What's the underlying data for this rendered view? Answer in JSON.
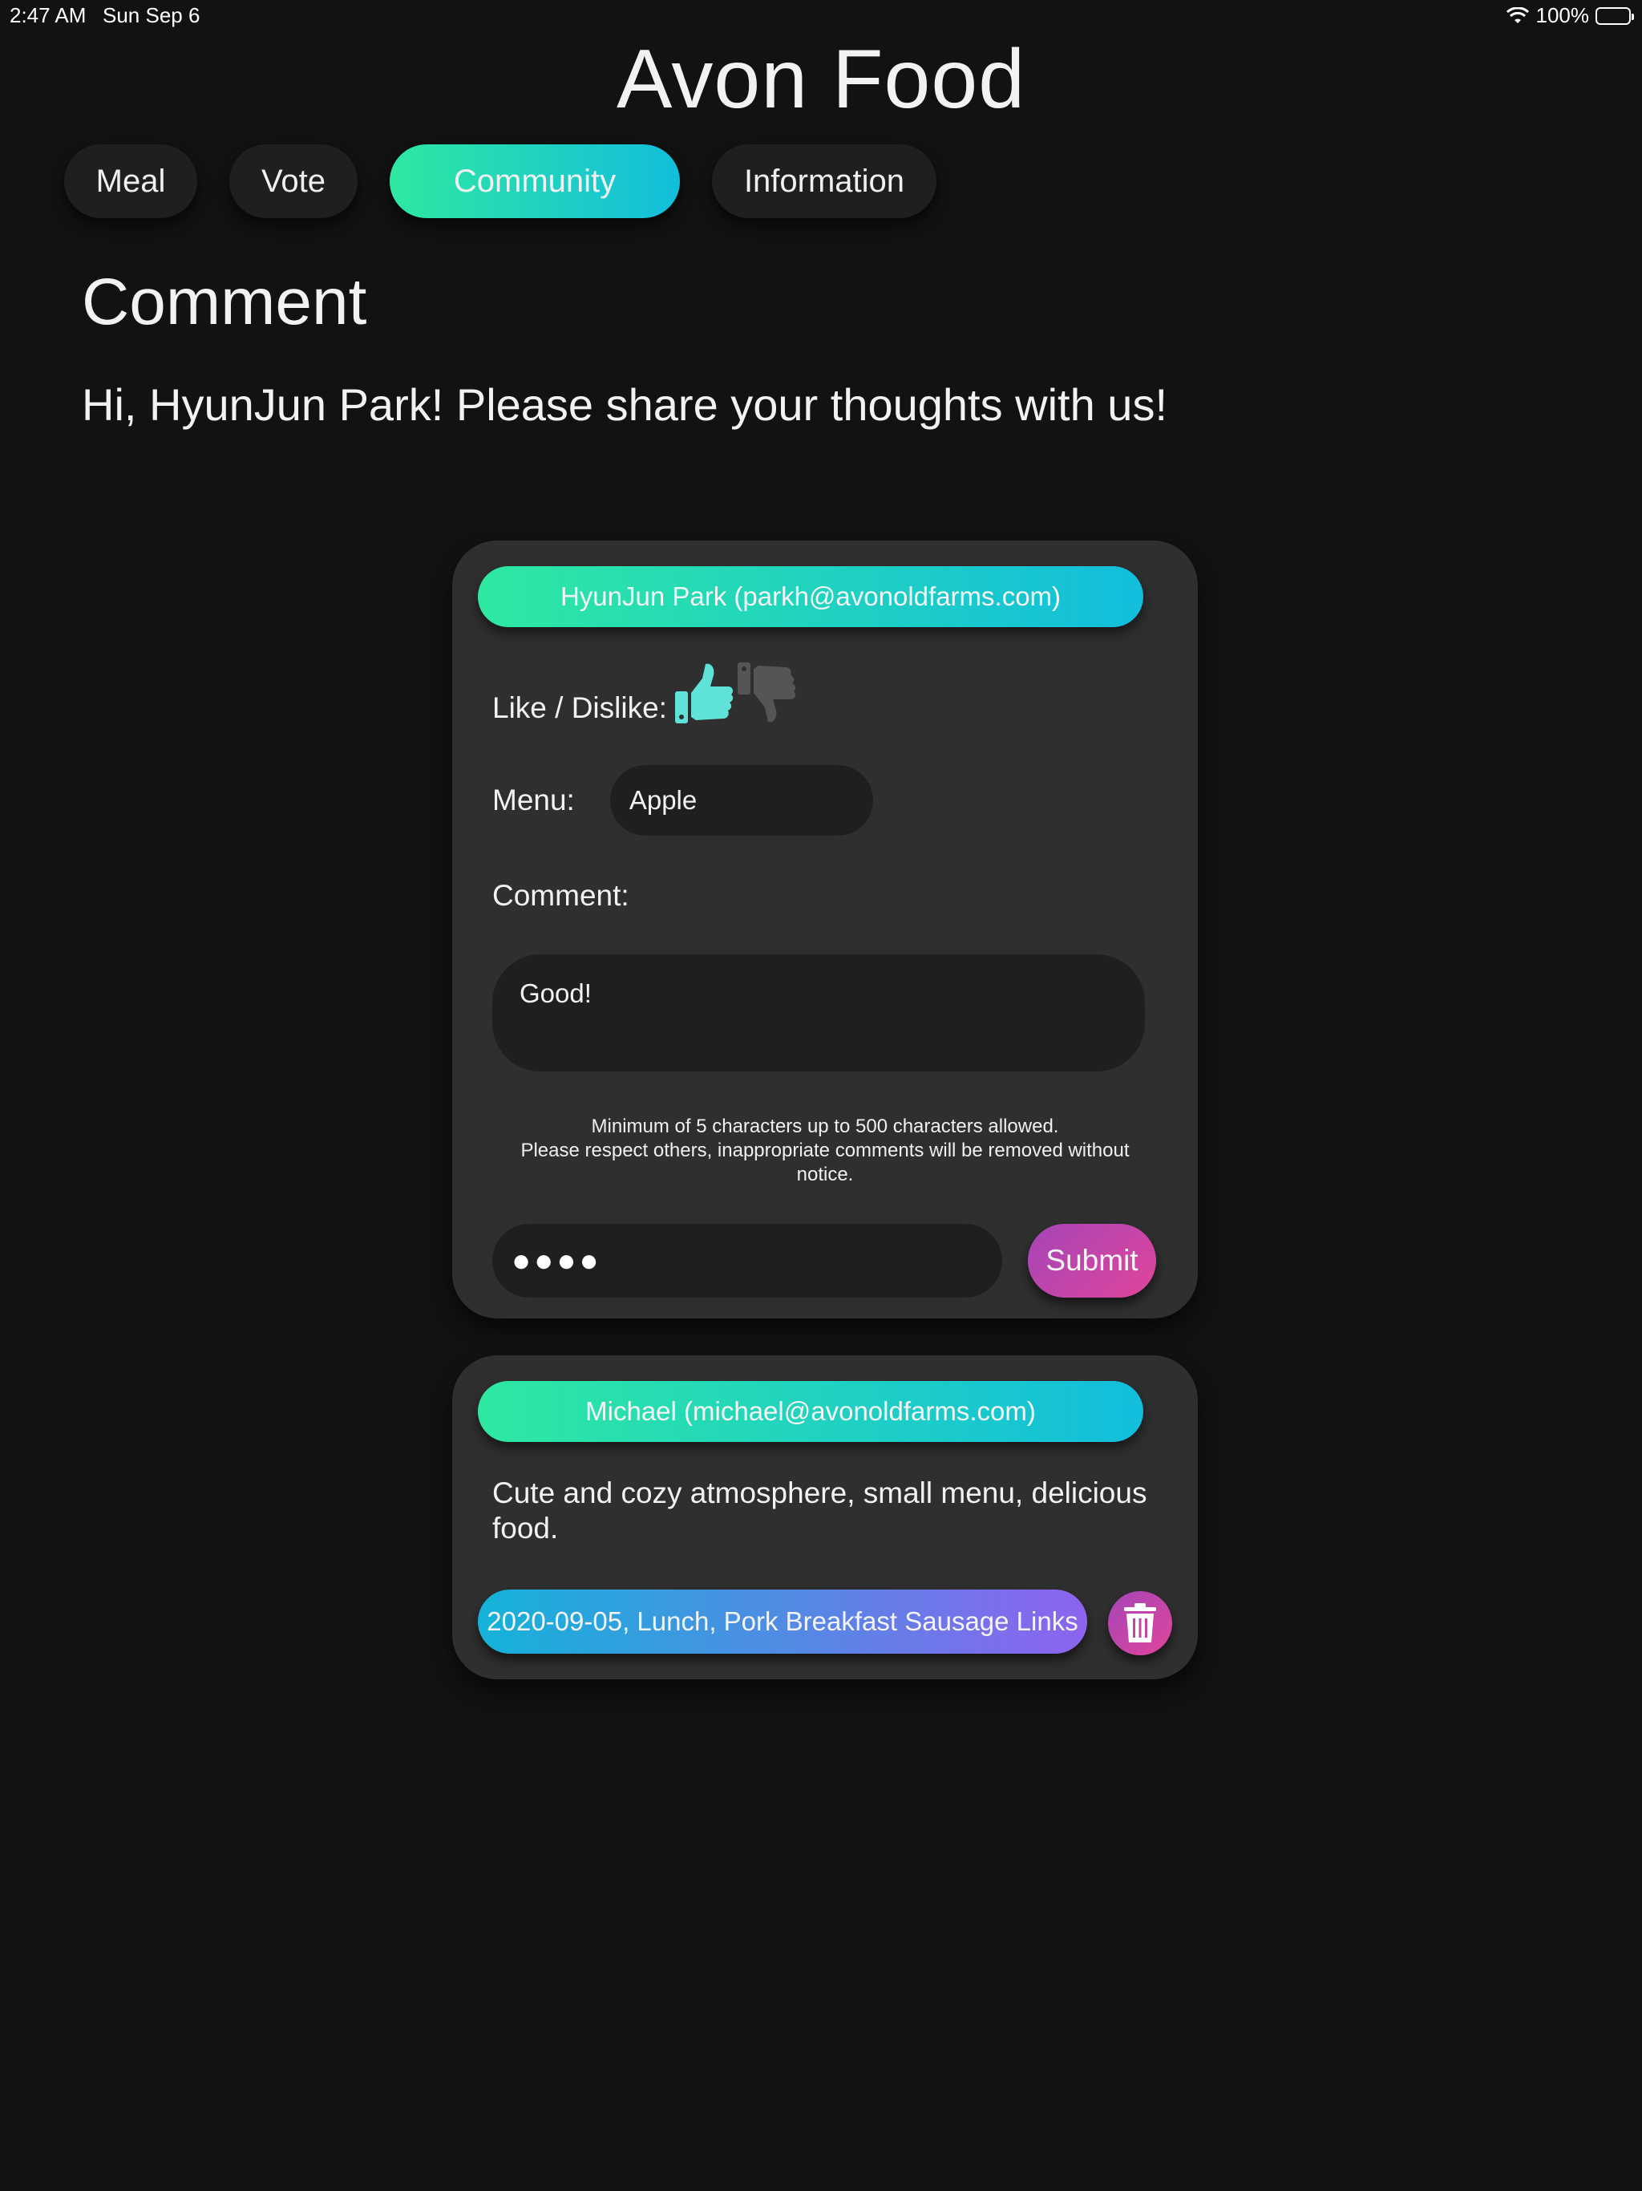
{
  "status_bar": {
    "time": "2:47 AM",
    "date": "Sun Sep 6",
    "battery": "100%"
  },
  "app": {
    "title": "Avon Food"
  },
  "tabs": [
    {
      "label": "Meal",
      "active": false
    },
    {
      "label": "Vote",
      "active": false
    },
    {
      "label": "Community",
      "active": true
    },
    {
      "label": "Information",
      "active": false
    }
  ],
  "page": {
    "title": "Comment",
    "greeting": "Hi, HyunJun Park! Please share your thoughts with us!"
  },
  "form": {
    "header": "HyunJun Park (parkh@avonoldfarms.com)",
    "like_label": "Like / Dislike:",
    "like_selected": "like",
    "menu_label": "Menu:",
    "menu_value": "Apple",
    "comment_label": "Comment:",
    "comment_value": "Good!",
    "rules_line1": "Minimum of 5 characters up to 500 characters allowed.",
    "rules_line2": "Please respect others, inappropriate comments will be removed without notice.",
    "pin_value": "●●●●",
    "submit_label": "Submit"
  },
  "reviews": [
    {
      "header": "Michael (michael@avonoldfarms.com)",
      "text": "Cute and cozy atmosphere, small menu, delicious food.",
      "meal": "2020-09-05, Lunch, Pork Breakfast Sausage Links"
    }
  ],
  "colors": {
    "background": "#121212",
    "card": "#2f2f2f",
    "field": "#1f1f1f",
    "accent_start": "#2ee8a2",
    "accent_end": "#12bedc",
    "pink_start": "#a545b7",
    "pink_end": "#e0459b",
    "like_active": "#5fe3d8",
    "dislike_inactive": "#555555"
  }
}
